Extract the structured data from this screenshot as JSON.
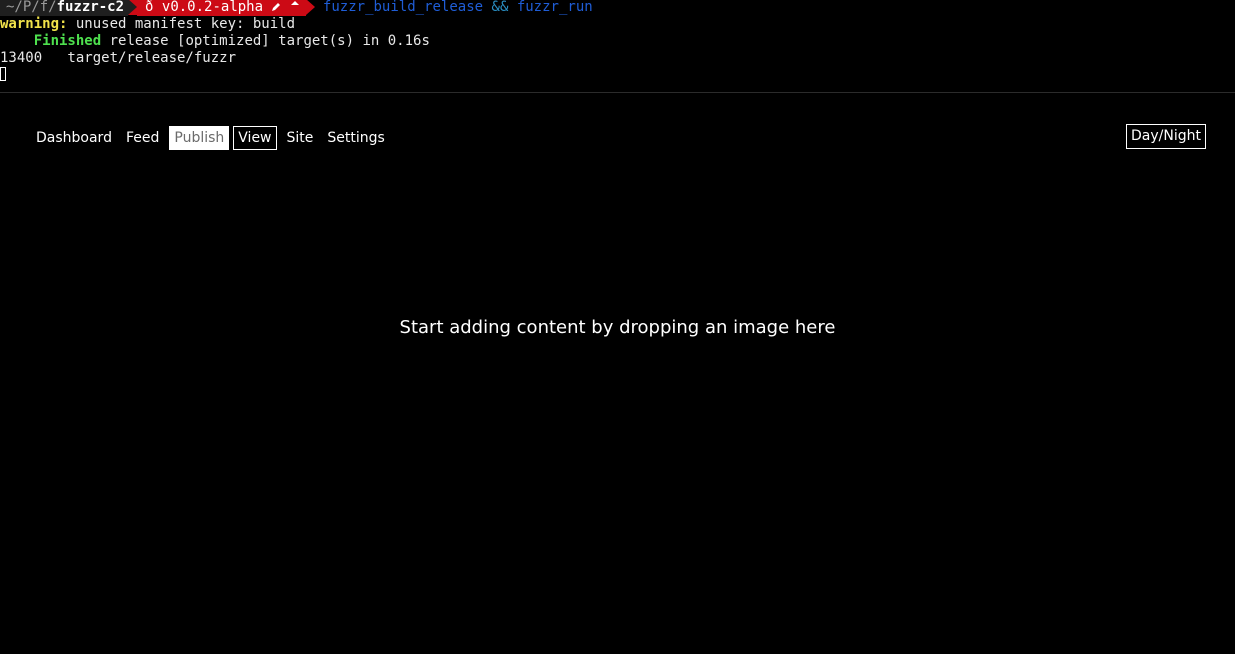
{
  "terminal": {
    "prompt": {
      "path_prefix": "~/P/f/",
      "path_current": "fuzzr-c2",
      "git_branch_icon": "git-branch-icon",
      "git_branch": "v0.0.2-alpha",
      "git_dirty_icon": "pencil-icon",
      "git_ahead_icon": "up-arrow-icon",
      "command_part1": "fuzzr_build_release",
      "command_operator": "&&",
      "command_part2": "fuzzr_run"
    },
    "lines": {
      "warning_label": "warning:",
      "warning_text": " unused manifest key: build",
      "finished_label": "Finished",
      "finished_text": " release [optimized] target(s) in 0.16s",
      "size_line": "13400   target/release/fuzzr"
    },
    "colors": {
      "path_bg": "#1f1f1f",
      "git_bg": "#cc0a15",
      "command": "#1f5dd6",
      "warning": "#f1e24a",
      "finished": "#4ee04e"
    }
  },
  "app": {
    "nav": {
      "items": [
        {
          "label": "Dashboard"
        },
        {
          "label": "Feed"
        },
        {
          "label": "Publish"
        },
        {
          "label": "View"
        },
        {
          "label": "Site"
        },
        {
          "label": "Settings"
        }
      ],
      "active": "Publish",
      "focused": "View"
    },
    "theme_toggle_label": "Day/Night",
    "dropzone_message": "Start adding content by dropping an image here"
  }
}
